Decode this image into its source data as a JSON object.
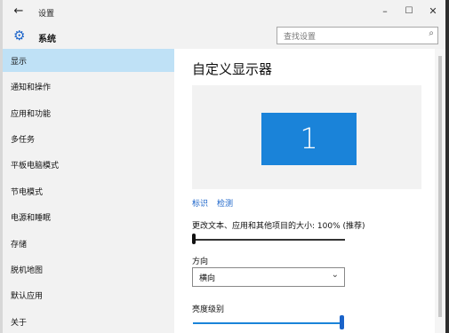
{
  "titlebar": {
    "back_glyph": "←",
    "title": "设置",
    "minimize_glyph": "–",
    "maximize_glyph": "☐",
    "close_glyph": "✕"
  },
  "header": {
    "section_icon": "gear-icon",
    "section_title": "系统",
    "search": {
      "placeholder": "查找设置",
      "icon": "search-icon"
    }
  },
  "sidebar": {
    "items": [
      {
        "label": "显示",
        "active": true
      },
      {
        "label": "通知和操作",
        "active": false
      },
      {
        "label": "应用和功能",
        "active": false
      },
      {
        "label": "多任务",
        "active": false
      },
      {
        "label": "平板电脑模式",
        "active": false
      },
      {
        "label": "节电模式",
        "active": false
      },
      {
        "label": "电源和睡眠",
        "active": false
      },
      {
        "label": "存储",
        "active": false
      },
      {
        "label": "脱机地图",
        "active": false
      },
      {
        "label": "默认应用",
        "active": false
      },
      {
        "label": "关于",
        "active": false
      }
    ]
  },
  "main": {
    "title": "自定义显示器",
    "monitor_number": "1",
    "links": {
      "identify": "标识",
      "detect": "检测"
    },
    "scale_label": "更改文本、应用和其他项目的大小: 100% (推荐)",
    "scale_value_percent": 0,
    "orientation_label": "方向",
    "orientation_value": "横向",
    "brightness_label": "亮度级别",
    "brightness_value_percent": 100
  },
  "colors": {
    "accent": "#1a83d9",
    "sidebar_active": "#bfe1f6",
    "chrome": "#f2f2f2"
  }
}
